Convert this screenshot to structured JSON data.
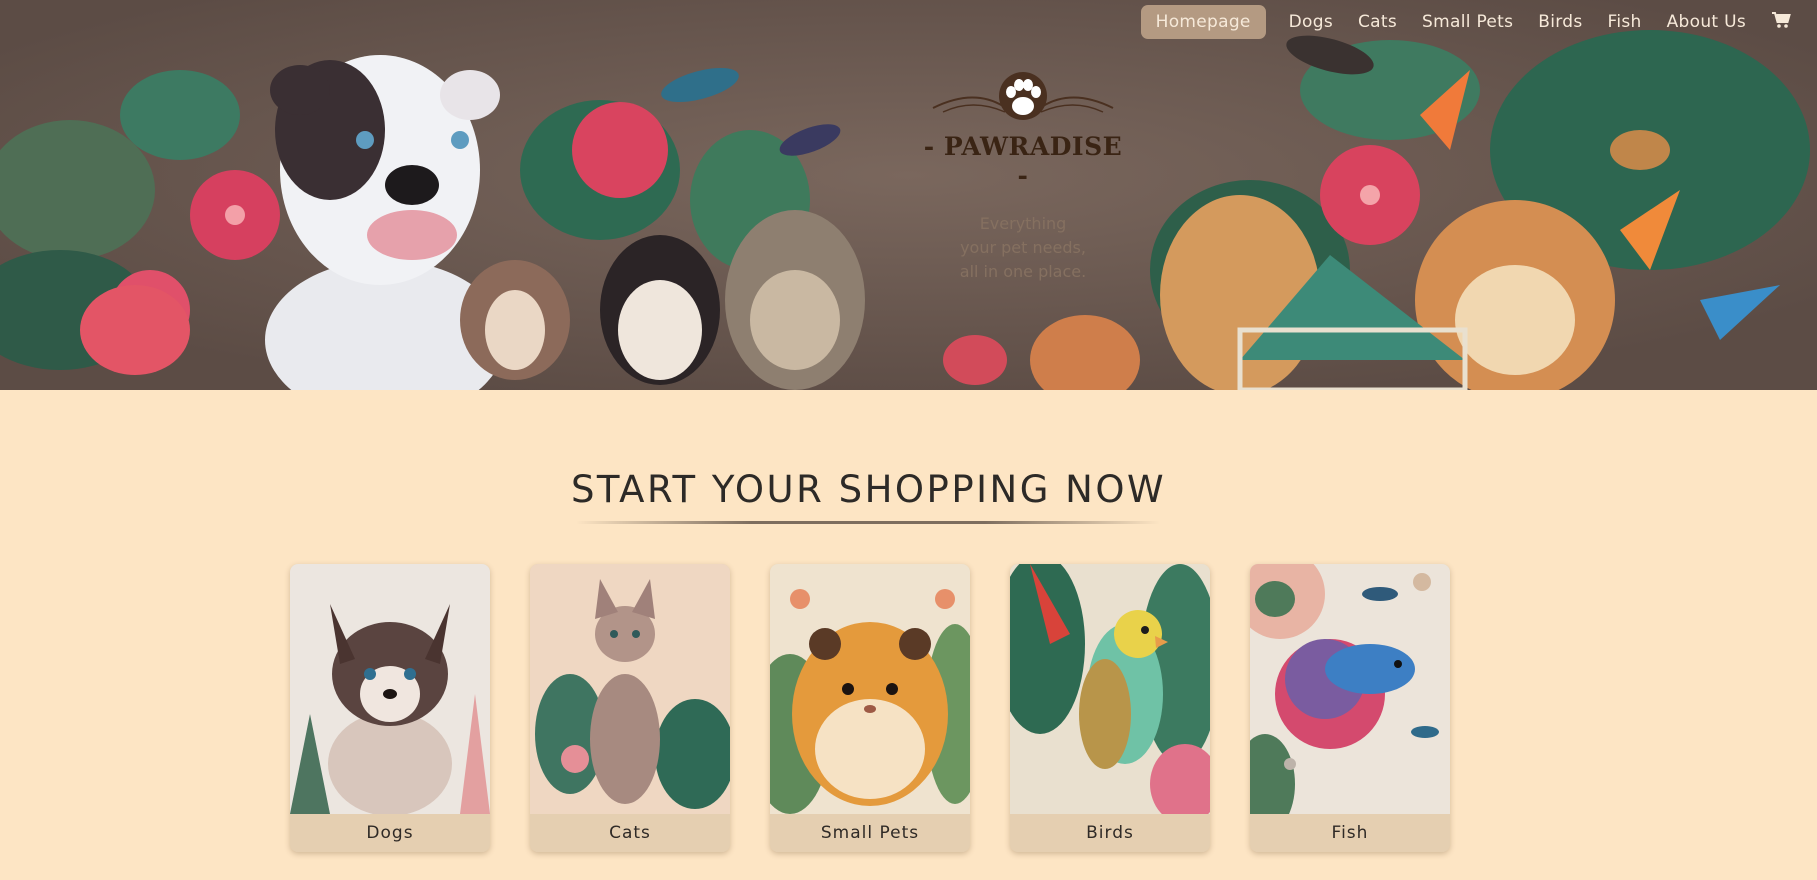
{
  "nav": {
    "items": [
      {
        "label": "Homepage",
        "active": true
      },
      {
        "label": "Dogs"
      },
      {
        "label": "Cats"
      },
      {
        "label": "Small Pets"
      },
      {
        "label": "Birds"
      },
      {
        "label": "Fish"
      },
      {
        "label": "About Us"
      }
    ],
    "cart_icon": "cart-icon"
  },
  "hero": {
    "logo_icon": "paw-print-icon",
    "brand": "- PAWRADISE -",
    "tagline_lines": [
      "Everything",
      "your pet needs,",
      "all in one place."
    ]
  },
  "shop": {
    "title": "START YOUR SHOPPING NOW",
    "categories": [
      {
        "label": "Dogs",
        "image": "puppy-illustration"
      },
      {
        "label": "Cats",
        "image": "sphynx-cat-illustration"
      },
      {
        "label": "Small Pets",
        "image": "hamster-illustration"
      },
      {
        "label": "Birds",
        "image": "parakeet-illustration"
      },
      {
        "label": "Fish",
        "image": "betta-fish-illustration"
      }
    ]
  },
  "colors": {
    "page_bg": "#fde5c4",
    "hero_bg": "#6b5a52",
    "nav_active_bg": "#b49a82",
    "card_label_bg": "#e5cfb1",
    "brand_text": "#3a2414"
  }
}
